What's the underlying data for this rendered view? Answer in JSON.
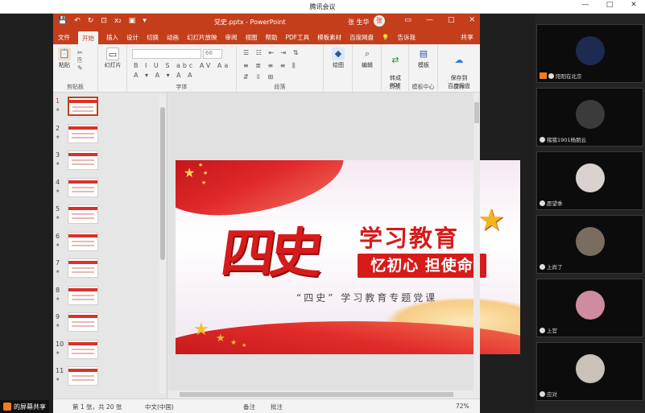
{
  "meeting": {
    "window_title": "腾讯会议",
    "controls": [
      "—",
      "□",
      "✕"
    ],
    "sharing_label": "的屏幕共享"
  },
  "ppt": {
    "doc_title": "党史.pptx - PowerPoint",
    "user_name": "张 生华",
    "avatar_initial": "张",
    "window_controls": [
      "▭",
      "—",
      "□",
      "✕"
    ],
    "qat": [
      "💾",
      "↶",
      "↻",
      "⊡",
      "x₂",
      "▣",
      "▾"
    ],
    "tabs": [
      "文件",
      "开始",
      "插入",
      "设计",
      "切换",
      "动画",
      "幻灯片放映",
      "审阅",
      "视图",
      "帮助",
      "PDF工具",
      "模板素材",
      "百度网盘",
      "💡",
      "告诉我"
    ],
    "active_tab": "开始",
    "share_label": "共享",
    "ribbon": {
      "clipboard": {
        "paste": "粘贴",
        "label": "剪贴板"
      },
      "slides": {
        "new_slide": "幻灯片",
        "label": ""
      },
      "font": {
        "size": "66",
        "label": "字体"
      },
      "paragraph": {
        "label": "段落"
      },
      "drawing": {
        "shapes": "绘图"
      },
      "editing": {
        "edit": "编辑"
      },
      "convert": {
        "pdf": "转成\nPDF",
        "label": "转换"
      },
      "template": {
        "tpl": "模板",
        "label": "模板中心"
      },
      "save": {
        "btn": "保存到\n百度网盘",
        "label": "保存"
      }
    },
    "thumbnails": [
      "1",
      "2",
      "3",
      "4",
      "5",
      "6",
      "7",
      "8",
      "9",
      "10",
      "11"
    ],
    "selected_slide": "1",
    "status": {
      "slide_info": "第 1 张，共 20 张",
      "lang": "中文(中国)",
      "notes": "备注",
      "comments": "批注",
      "zoom": "72%"
    }
  },
  "slide": {
    "big_title": "四史",
    "sub_title": "学习教育",
    "banner": "忆初心 担使命",
    "caption": "“四史” 学习教育专题党课"
  },
  "participants": [
    {
      "name": "阳阳在北京",
      "color": "#1d2b52",
      "host": true
    },
    {
      "name": "猪猪1901杨朋云",
      "color": "#3b3b3b",
      "host": false
    },
    {
      "name": "愿望季",
      "color": "#d9d2cf",
      "host": false
    },
    {
      "name": "上尚了",
      "color": "#7a6c5e",
      "host": false
    },
    {
      "name": "上官",
      "color": "#cf8ba0",
      "host": false
    },
    {
      "name": "应对",
      "color": "#c8c2b8",
      "host": false
    }
  ]
}
